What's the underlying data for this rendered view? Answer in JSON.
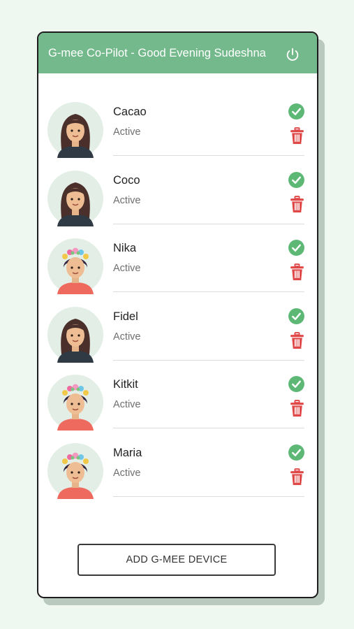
{
  "header": {
    "title": "G-mee Co-Pilot - Good Evening Sudeshna",
    "color": "#74b98b"
  },
  "devices": [
    {
      "name": "Cacao",
      "status": "Active",
      "avatar": "girl-long-hair"
    },
    {
      "name": "Coco",
      "status": "Active",
      "avatar": "girl-long-hair"
    },
    {
      "name": "Nika",
      "status": "Active",
      "avatar": "girl-flower-crown"
    },
    {
      "name": "Fidel",
      "status": "Active",
      "avatar": "girl-long-hair"
    },
    {
      "name": "Kitkit",
      "status": "Active",
      "avatar": "girl-flower-crown"
    },
    {
      "name": "Maria",
      "status": "Active",
      "avatar": "girl-flower-crown"
    }
  ],
  "icons": {
    "check_color": "#5cb874",
    "trash_color": "#e04848"
  },
  "add_button": {
    "label": "ADD G-MEE DEVICE"
  }
}
